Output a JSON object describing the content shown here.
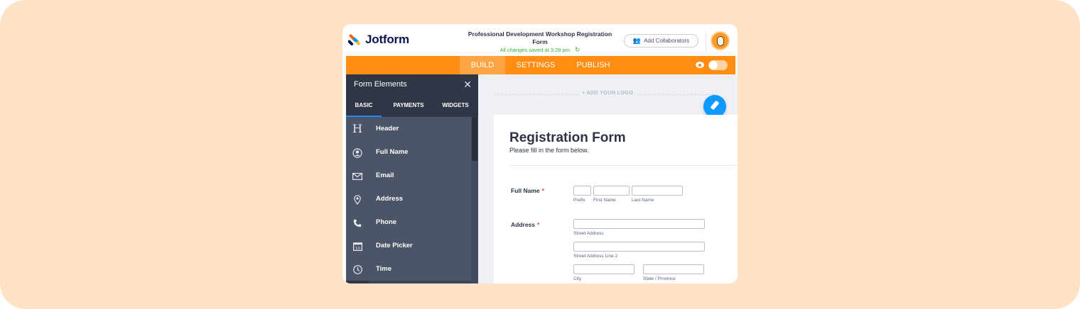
{
  "app": {
    "logo_text": "Jotform",
    "form_title": "Professional Development Workshop Registration Form",
    "saved_status": "All changes saved at 3:28 pm.",
    "collab_label": "Add Collaborators"
  },
  "nav": {
    "tabs": [
      {
        "label": "BUILD",
        "active": true
      },
      {
        "label": "SETTINGS",
        "active": false
      },
      {
        "label": "PUBLISH",
        "active": false
      }
    ]
  },
  "sidebar": {
    "title": "Form Elements",
    "tabs": [
      {
        "label": "BASIC",
        "active": true
      },
      {
        "label": "PAYMENTS",
        "active": false
      },
      {
        "label": "WIDGETS",
        "active": false
      }
    ],
    "items": [
      {
        "label": "Header",
        "icon": "heading-icon"
      },
      {
        "label": "Full Name",
        "icon": "user-icon"
      },
      {
        "label": "Email",
        "icon": "envelope-icon"
      },
      {
        "label": "Address",
        "icon": "map-pin-icon"
      },
      {
        "label": "Phone",
        "icon": "phone-icon"
      },
      {
        "label": "Date Picker",
        "icon": "calendar-icon"
      },
      {
        "label": "Time",
        "icon": "clock-icon"
      }
    ]
  },
  "canvas": {
    "add_logo": "+ ADD YOUR LOGO",
    "form": {
      "title": "Registration Form",
      "subtitle": "Please fill in the form below.",
      "fields": {
        "full_name": {
          "label": "Full Name",
          "required": "*",
          "sublabels": [
            "Prefix",
            "First Name",
            "Last Name"
          ]
        },
        "address": {
          "label": "Address",
          "required": "*",
          "sublabels": [
            "Street Address",
            "Street Address Line 2",
            "City",
            "State / Province"
          ]
        }
      }
    }
  },
  "colors": {
    "brand_orange": "#ff8c13",
    "sidebar_dark": "#3b4456",
    "accent_blue": "#0d99ff",
    "success_green": "#3cb23c",
    "page_bg": "#fde3c3"
  }
}
